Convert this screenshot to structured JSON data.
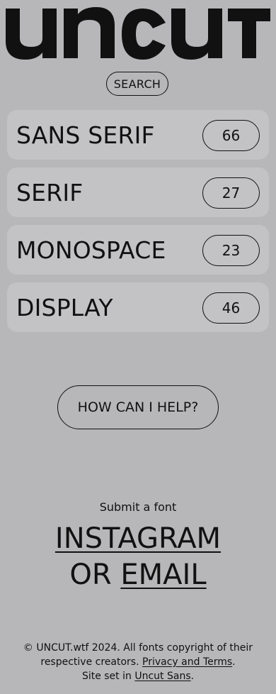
{
  "header": {
    "logo_text": "UNCUT",
    "search_label": "SEARCH"
  },
  "categories": [
    {
      "name": "SANS SERIF",
      "count": "66"
    },
    {
      "name": "SERIF",
      "count": "27"
    },
    {
      "name": "MONOSPACE",
      "count": "23"
    },
    {
      "name": "DISPLAY",
      "count": "46"
    }
  ],
  "help": {
    "label": "HOW CAN I HELP?"
  },
  "submit": {
    "label": "Submit a font",
    "instagram": "INSTAGRAM",
    "or_text": "OR",
    "email": "EMAIL"
  },
  "footer": {
    "copyright": "© UNCUT.wtf 2024. All fonts copyright of their respective creators.",
    "privacy_link": "Privacy and Terms",
    "period1": ".",
    "site_set_text": "Site set in",
    "font_link": "Uncut Sans",
    "period2": "."
  },
  "colors": {
    "background": "#b7b6b9",
    "card": "#c3c2c5",
    "ink": "#111111"
  }
}
